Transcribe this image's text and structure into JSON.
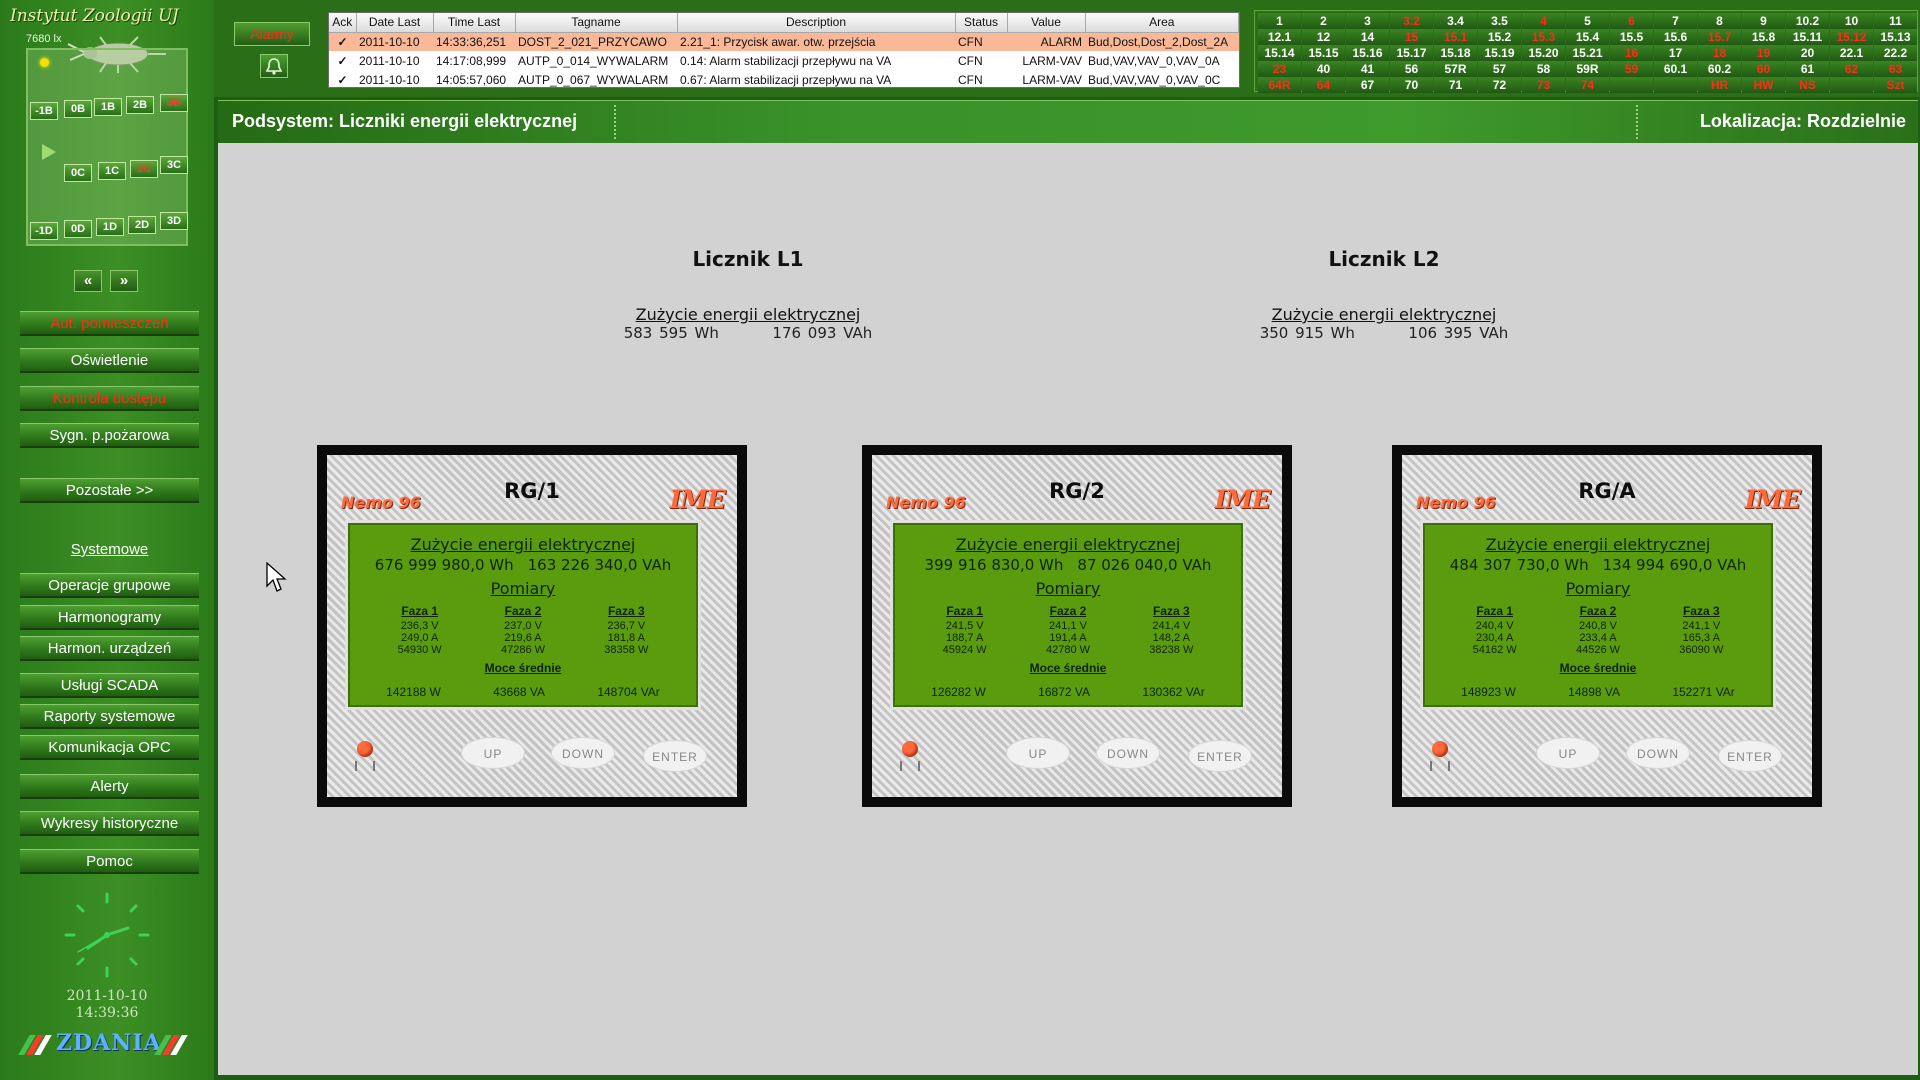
{
  "sidebar": {
    "institute": "Instytut Zoologii UJ",
    "lux": "7680 lx",
    "floors": [
      {
        "label": "-1B",
        "alarm": false
      },
      {
        "label": "0B",
        "alarm": false
      },
      {
        "label": "1B",
        "alarm": false
      },
      {
        "label": "2B",
        "alarm": false
      },
      {
        "label": "3B",
        "alarm": true
      },
      {
        "label": "0C",
        "alarm": false
      },
      {
        "label": "1C",
        "alarm": false
      },
      {
        "label": "2C",
        "alarm": true
      },
      {
        "label": "3C",
        "alarm": false
      },
      {
        "label": "-1D",
        "alarm": false
      },
      {
        "label": "0D",
        "alarm": false
      },
      {
        "label": "1D",
        "alarm": false
      },
      {
        "label": "2D",
        "alarm": false
      },
      {
        "label": "3D",
        "alarm": false
      }
    ],
    "prev": "«",
    "next": "»",
    "menu": [
      {
        "label": "Aut. pomieszczeń",
        "alarm": true
      },
      {
        "label": "Oświetlenie",
        "alarm": false
      },
      {
        "label": "Kontrola dostępu",
        "alarm": true
      },
      {
        "label": "Sygn. p.pożarowa",
        "alarm": false
      },
      {
        "label": "Pozostałe  >>",
        "alarm": false
      }
    ],
    "system_header": "Systemowe",
    "system_menu": [
      "Operacje grupowe",
      "Harmonogramy",
      "Harmon. urządzeń",
      "Usługi SCADA",
      "Raporty systemowe",
      "Komunikacja OPC",
      "Alerty",
      "Wykresy historyczne",
      "Pomoc"
    ],
    "date": "2011-10-10",
    "time": "14:39:36",
    "logo": "ZDANIA"
  },
  "topbar": {
    "alarm_button": "Alarmy",
    "table_headers": [
      "Ack",
      "Date Last",
      "Time Last",
      "Tagname",
      "Description",
      "Status",
      "Value",
      "Area"
    ],
    "rows": [
      {
        "ack": "✓",
        "date": "2011-10-10",
        "time": "14:33:36,251",
        "tag": "DOST_2_021_PRZYCAWO",
        "desc": "2.21_1: Przycisk awar. otw. przejścia",
        "status": "CFN",
        "value": "ALARM",
        "area": "Bud,Dost,Dost_2,Dost_2A",
        "highlight": true
      },
      {
        "ack": "✓",
        "date": "2011-10-10",
        "time": "14:17:08,999",
        "tag": "AUTP_0_014_WYWALARM",
        "desc": "0.14: Alarm stabilizacji przepływu na VA",
        "status": "CFN",
        "value": "LARM-VAV",
        "area": "Bud,VAV,VAV_0,VAV_0A",
        "highlight": false
      },
      {
        "ack": "✓",
        "date": "2011-10-10",
        "time": "14:05:57,060",
        "tag": "AUTP_0_067_WYWALARM",
        "desc": "0.67: Alarm stabilizacji przepływu na VA",
        "status": "CFN",
        "value": "LARM-VAV",
        "area": "Bud,VAV,VAV_0,VAV_0C",
        "highlight": false
      }
    ],
    "room_grid": [
      [
        {
          "l": "1"
        },
        {
          "l": "2"
        },
        {
          "l": "3"
        },
        {
          "l": "3.2",
          "a": true
        },
        {
          "l": "3.4"
        },
        {
          "l": "3.5"
        },
        {
          "l": "4",
          "a": true
        },
        {
          "l": "5"
        },
        {
          "l": "6",
          "a": true
        },
        {
          "l": "7"
        },
        {
          "l": "8"
        },
        {
          "l": "9"
        },
        {
          "l": "10.2"
        },
        {
          "l": "10"
        },
        {
          "l": "11"
        }
      ],
      [
        {
          "l": "12.1"
        },
        {
          "l": "12"
        },
        {
          "l": "14"
        },
        {
          "l": "15",
          "a": true
        },
        {
          "l": "15.1",
          "a": true
        },
        {
          "l": "15.2"
        },
        {
          "l": "15.3",
          "a": true
        },
        {
          "l": "15.4"
        },
        {
          "l": "15.5"
        },
        {
          "l": "15.6"
        },
        {
          "l": "15.7",
          "a": true
        },
        {
          "l": "15.8"
        },
        {
          "l": "15.11"
        },
        {
          "l": "15.12",
          "a": true
        },
        {
          "l": "15.13"
        }
      ],
      [
        {
          "l": "15.14"
        },
        {
          "l": "15.15"
        },
        {
          "l": "15.16"
        },
        {
          "l": "15.17"
        },
        {
          "l": "15.18"
        },
        {
          "l": "15.19"
        },
        {
          "l": "15.20"
        },
        {
          "l": "15.21"
        },
        {
          "l": "16",
          "a": true
        },
        {
          "l": "17"
        },
        {
          "l": "18",
          "a": true
        },
        {
          "l": "19",
          "a": true
        },
        {
          "l": "20"
        },
        {
          "l": "22.1"
        },
        {
          "l": "22.2"
        }
      ],
      [
        {
          "l": "23",
          "a": true
        },
        {
          "l": "40"
        },
        {
          "l": "41"
        },
        {
          "l": "56"
        },
        {
          "l": "57R"
        },
        {
          "l": "57"
        },
        {
          "l": "58"
        },
        {
          "l": "59R"
        },
        {
          "l": "59",
          "a": true
        },
        {
          "l": "60.1"
        },
        {
          "l": "60.2"
        },
        {
          "l": "60",
          "a": true
        },
        {
          "l": "61"
        },
        {
          "l": "62",
          "a": true
        },
        {
          "l": "63",
          "a": true
        }
      ],
      [
        {
          "l": "64R",
          "a": true
        },
        {
          "l": "64",
          "a": true
        },
        {
          "l": "67"
        },
        {
          "l": "70"
        },
        {
          "l": "71"
        },
        {
          "l": "72"
        },
        {
          "l": "73",
          "a": true
        },
        {
          "l": "74",
          "a": true
        },
        {
          "l": ""
        },
        {
          "l": ""
        },
        {
          "l": "HR",
          "a": true
        },
        {
          "l": "HW",
          "a": true
        },
        {
          "l": "NS",
          "a": true
        },
        {
          "l": ""
        },
        {
          "l": "Szt",
          "a": true
        }
      ]
    ]
  },
  "subsystem": {
    "title": "Podsystem: Liczniki energii elektrycznej",
    "location": "Lokalizacja: Rozdzielnie"
  },
  "meters": [
    {
      "name": "Licznik L1",
      "subtitle": "Zużycie energii elektrycznej",
      "wh": "583 595 Wh",
      "vah": "176 093 VAh"
    },
    {
      "name": "Licznik L2",
      "subtitle": "Zużycie energii elektrycznej",
      "wh": "350 915 Wh",
      "vah": "106 395 VAh"
    }
  ],
  "devices": [
    {
      "brand": "Nemo 96",
      "name": "RG/1",
      "logo": "IME",
      "energy_title": "Zużycie energii elektrycznej",
      "wh": "676 999 980,0 Wh",
      "vah": "163 226 340,0 VAh",
      "measurements": "Pomiary",
      "phases": [
        {
          "label": "Faza 1",
          "v": "236,3 V",
          "a": "249,0 A",
          "w": "54930 W"
        },
        {
          "label": "Faza 2",
          "v": "237,0 V",
          "a": "219,6 A",
          "w": "47286 W"
        },
        {
          "label": "Faza 3",
          "v": "236,7 V",
          "a": "181,8 A",
          "w": "38358 W"
        }
      ],
      "avg_title": "Moce średnie",
      "avg": [
        "142188 W",
        "43668 VA",
        "148704 VAr"
      ],
      "keys": [
        "UP",
        "DOWN",
        "ENTER"
      ]
    },
    {
      "brand": "Nemo 96",
      "name": "RG/2",
      "logo": "IME",
      "energy_title": "Zużycie energii elektrycznej",
      "wh": "399 916 830,0 Wh",
      "vah": "87 026 040,0 VAh",
      "measurements": "Pomiary",
      "phases": [
        {
          "label": "Faza 1",
          "v": "241,5 V",
          "a": "188,7 A",
          "w": "45924 W"
        },
        {
          "label": "Faza 2",
          "v": "241,1 V",
          "a": "191,4 A",
          "w": "42780 W"
        },
        {
          "label": "Faza 3",
          "v": "241,4 V",
          "a": "148,2 A",
          "w": "38238 W"
        }
      ],
      "avg_title": "Moce średnie",
      "avg": [
        "126282 W",
        "16872 VA",
        "130362 VAr"
      ],
      "keys": [
        "UP",
        "DOWN",
        "ENTER"
      ]
    },
    {
      "brand": "Nemo 96",
      "name": "RG/A",
      "logo": "IME",
      "energy_title": "Zużycie energii elektrycznej",
      "wh": "484 307 730,0 Wh",
      "vah": "134 994 690,0 VAh",
      "measurements": "Pomiary",
      "phases": [
        {
          "label": "Faza 1",
          "v": "240,4 V",
          "a": "230,4 A",
          "w": "54162 W"
        },
        {
          "label": "Faza 2",
          "v": "240,8 V",
          "a": "233,4 A",
          "w": "44526 W"
        },
        {
          "label": "Faza 3",
          "v": "241,1 V",
          "a": "165,3 A",
          "w": "36090 W"
        }
      ],
      "avg_title": "Moce średnie",
      "avg": [
        "148923 W",
        "14898 VA",
        "152271 VAr"
      ],
      "keys": [
        "UP",
        "DOWN",
        "ENTER"
      ]
    }
  ],
  "colors": {
    "accent": "#2f7a1b",
    "alarm": "#ff2c1c",
    "lcd": "#5a9c0e",
    "panel": "#d2d2d2"
  }
}
